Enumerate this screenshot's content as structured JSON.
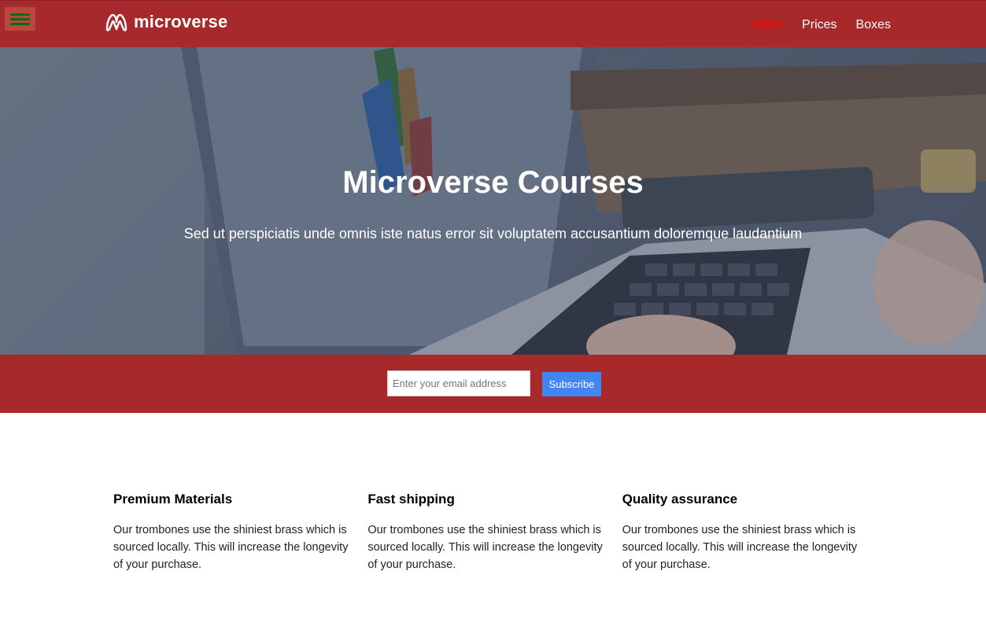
{
  "header": {
    "brand": "microverse",
    "nav": [
      {
        "label": "Video",
        "active": true
      },
      {
        "label": "Prices",
        "active": false
      },
      {
        "label": "Boxes",
        "active": false
      }
    ],
    "menu_icon": "hamburger-menu-icon",
    "colors": {
      "bar": "#a7292b",
      "active_link": "#ff0000",
      "menu_lines": "#0b6a0b"
    }
  },
  "hero": {
    "title": "Microverse Courses",
    "subtitle": "Sed ut perspiciatis unde omnis iste natus error sit voluptatem accusantium doloremque laudantium"
  },
  "subscribe": {
    "email_placeholder": "Enter your email address",
    "button_label": "Subscribe",
    "button_color": "#4285f4"
  },
  "features": [
    {
      "title": "Premium Materials",
      "text": "Our trombones use the shiniest brass which is sourced locally. This will increase the longevity of your purchase."
    },
    {
      "title": "Fast shipping",
      "text": "Our trombones use the shiniest brass which is sourced locally. This will increase the longevity of your purchase."
    },
    {
      "title": "Quality assurance",
      "text": "Our trombones use the shiniest brass which is sourced locally. This will increase the longevity of your purchase."
    }
  ]
}
